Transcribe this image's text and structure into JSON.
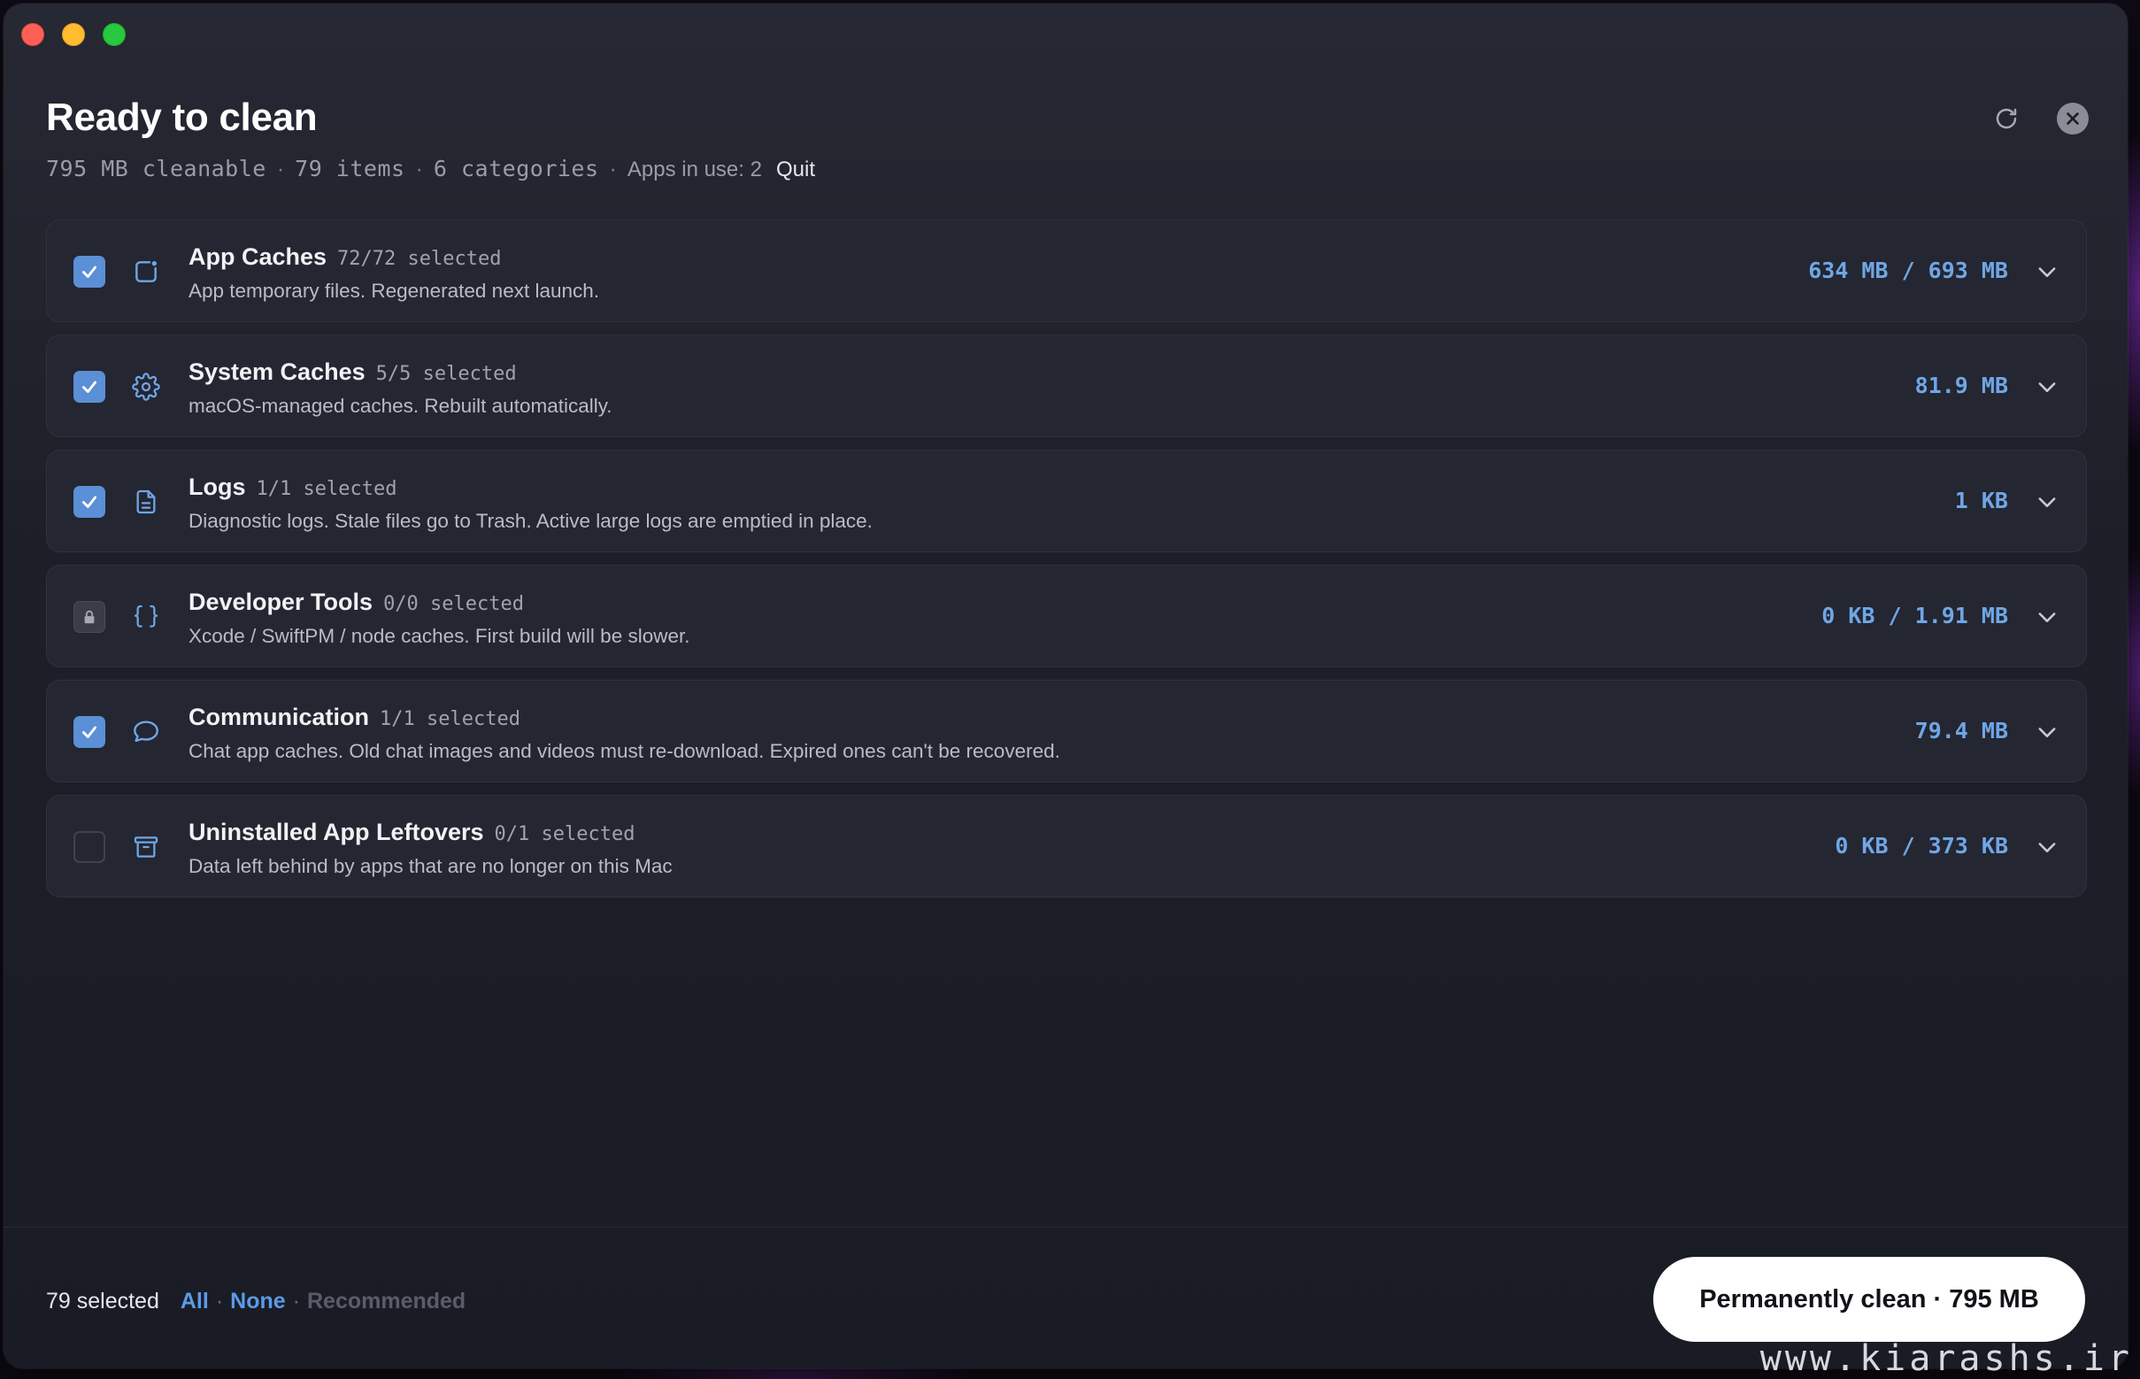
{
  "header": {
    "title": "Ready to clean",
    "cleanable": "795 MB cleanable",
    "items": "79 items",
    "categories": "6 categories",
    "apps_in_use": "Apps in use: 2",
    "quit_label": "Quit",
    "separator": "·"
  },
  "categories": [
    {
      "name": "App Caches",
      "selected": "72/72 selected",
      "description": "App temporary files. Regenerated next launch.",
      "size": "634 MB / 693 MB",
      "state": "checked",
      "icon": "app-window-icon"
    },
    {
      "name": "System Caches",
      "selected": "5/5 selected",
      "description": "macOS-managed caches. Rebuilt automatically.",
      "size": "81.9 MB",
      "state": "checked",
      "icon": "gear-icon"
    },
    {
      "name": "Logs",
      "selected": "1/1 selected",
      "description": "Diagnostic logs. Stale files go to Trash. Active large logs are emptied in place.",
      "size": "1 KB",
      "state": "checked",
      "icon": "document-icon"
    },
    {
      "name": "Developer Tools",
      "selected": "0/0 selected",
      "description": "Xcode / SwiftPM / node caches. First build will be slower.",
      "size": "0 KB / 1.91 MB",
      "state": "locked",
      "icon": "curly-braces-icon"
    },
    {
      "name": "Communication",
      "selected": "1/1 selected",
      "description": "Chat app caches. Old chat images and videos must re-download. Expired ones can't be recovered.",
      "size": "79.4 MB",
      "state": "checked",
      "icon": "chat-bubble-icon"
    },
    {
      "name": "Uninstalled App Leftovers",
      "selected": "0/1 selected",
      "description": "Data left behind by apps that are no longer on this Mac",
      "size": "0 KB / 373 KB",
      "state": "empty",
      "icon": "archive-box-icon"
    }
  ],
  "footer": {
    "selected_count": "79 selected",
    "all_label": "All",
    "none_label": "None",
    "recommended_label": "Recommended",
    "separator": "·",
    "clean_button": "Permanently clean · 795 MB"
  },
  "watermark": "www.kiarashs.ir",
  "colors": {
    "accent": "#5b8fd6",
    "size_text": "#6fa6e6",
    "link": "#5b9ae8",
    "background": "#1d1f28",
    "row": "#242631"
  }
}
